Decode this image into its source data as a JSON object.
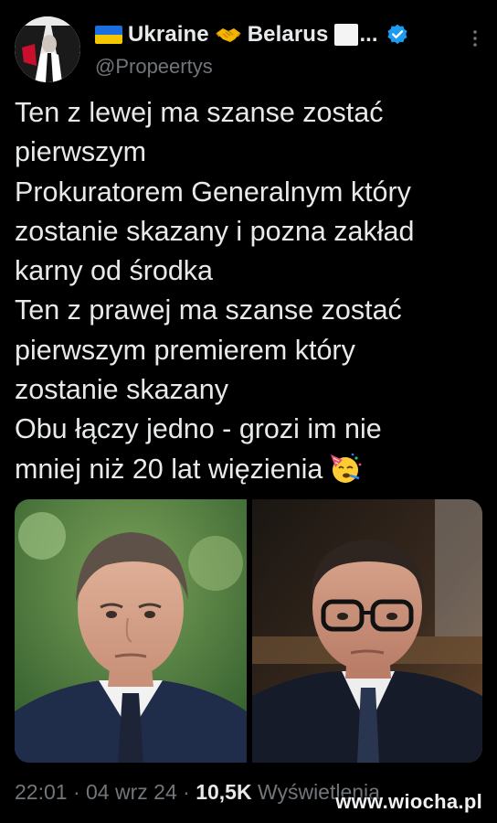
{
  "author": {
    "display_name_part1": "Ukraine",
    "display_name_part2": "Belarus",
    "ellipsis": "...",
    "handle": "@Propeertys",
    "avatar_icon": "person-portrait-icon",
    "verified_icon": "verified-badge-icon",
    "accent_color": "#1d9bf0"
  },
  "tweet": {
    "lines": [
      "Ten z lewej ma szanse zostać",
      "pierwszym",
      "Prokuratorem Generalnym który",
      "zostanie skazany i pozna zakład",
      "karny od środka",
      "Ten z prawej ma szanse zostać",
      "pierwszym premierem który",
      "zostanie skazany",
      "Obu łączy jedno - grozi im nie",
      "mniej niż 20 lat więzienia"
    ],
    "emoji": "partying-face-icon"
  },
  "meta": {
    "time": "22:01",
    "separator": " · ",
    "date": "04 wrz 24",
    "views_count": "10,5K",
    "views_label": "Wyświetlenia"
  },
  "watermark": "www.wiocha.pl"
}
